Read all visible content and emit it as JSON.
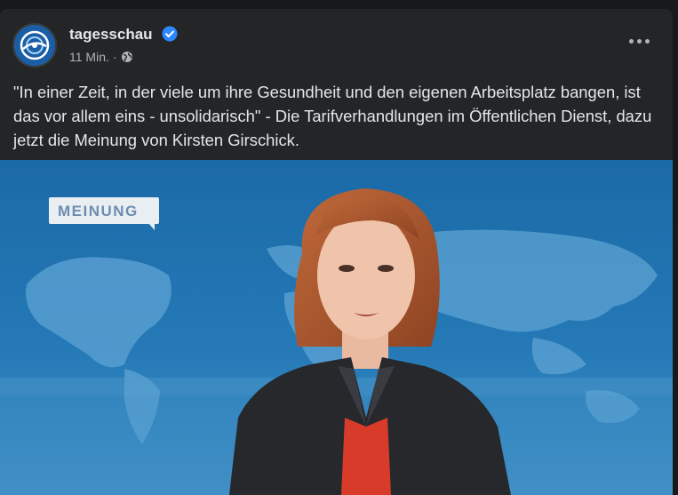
{
  "post": {
    "page_name": "tagesschau",
    "time": "11 Min.",
    "separator": "·",
    "text": "\"In einer Zeit, in der viele um ihre Gesundheit und den eigenen Arbeitsplatz bangen, ist das vor allem eins - unsolidarisch\" - Die Tarifverhandlungen im Öffentlichen Dienst, dazu jetzt die Meinung von Kirsten Girschick."
  },
  "video": {
    "badge_label": "MEINUNG"
  },
  "icons": {
    "avatar": "tagesschau-logo-icon",
    "verified": "verified-badge-icon",
    "audience": "globe-icon",
    "more": "more-options-icon"
  },
  "colors": {
    "card_bg": "#242526",
    "text_primary": "#e4e6eb",
    "text_secondary": "#b0b3b8",
    "verified_blue": "#2d88ff",
    "studio_blue": "#1d6ca8"
  }
}
